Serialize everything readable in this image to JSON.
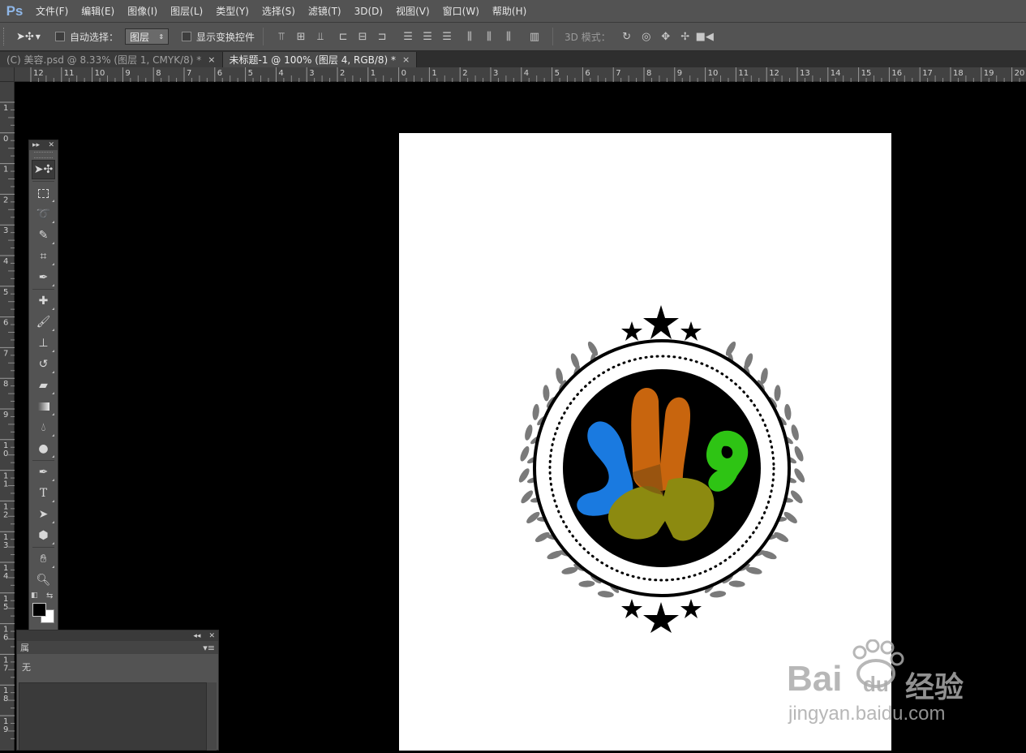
{
  "app": {
    "logo": "Ps"
  },
  "menu": [
    "文件(F)",
    "编辑(E)",
    "图像(I)",
    "图层(L)",
    "类型(Y)",
    "选择(S)",
    "滤镜(T)",
    "3D(D)",
    "视图(V)",
    "窗口(W)",
    "帮助(H)"
  ],
  "options": {
    "auto_select_label": "自动选择：",
    "auto_select_value": "图层",
    "show_transform_label": "显示变换控件",
    "mode_3d_label": "3D 模式："
  },
  "tabs": [
    {
      "label": "(C) 美容.psd @ 8.33% (图层 1, CMYK/8) *",
      "close": "×"
    },
    {
      "label": "未标题-1 @ 100% (图层 4, RGB/8) *",
      "close": "×"
    }
  ],
  "ruler": {
    "h_ticks": [
      "12",
      "11",
      "10",
      "9",
      "8",
      "7",
      "6",
      "5",
      "4",
      "3",
      "2",
      "1",
      "0",
      "1",
      "2",
      "3",
      "4",
      "5",
      "6",
      "7",
      "8",
      "9",
      "10",
      "11",
      "12",
      "13",
      "14",
      "15",
      "16",
      "17",
      "18",
      "19",
      "20"
    ],
    "v_ticks": [
      "1",
      "0",
      "1",
      "2",
      "3",
      "4",
      "5",
      "6",
      "7",
      "8",
      "9",
      "10",
      "11",
      "12",
      "13",
      "14",
      "15",
      "16",
      "17",
      "18",
      "19"
    ]
  },
  "panel": {
    "tab_label": "属",
    "row_label": "无"
  },
  "watermark": {
    "brand": "Bai",
    "brand2": "du",
    "cn": "经验",
    "url": "jingyan.baidu.com"
  },
  "colors": {
    "accent": "#8fb7e8",
    "foreground": "#000000",
    "background": "#ffffff"
  }
}
